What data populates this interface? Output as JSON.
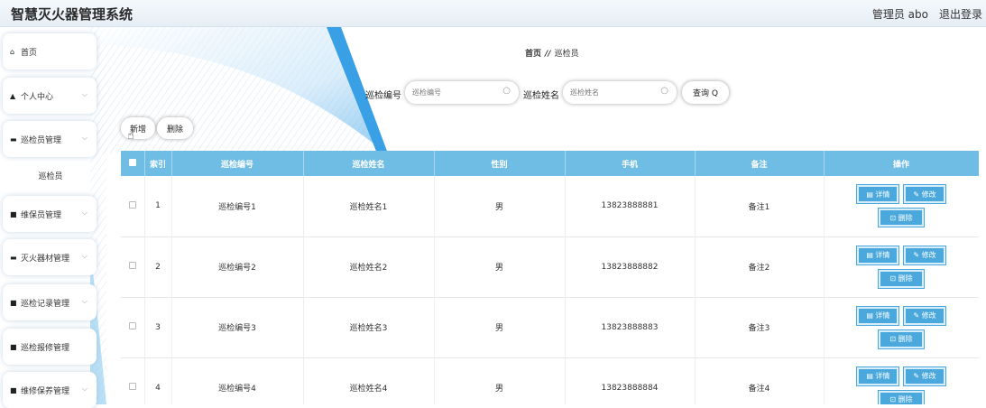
{
  "header": {
    "title": "智慧灭火器管理系统",
    "user": "管理员 abo",
    "logout": "退出登录"
  },
  "sidebar": {
    "items": [
      {
        "icon": "home-icon",
        "glyph": "⌂",
        "label": "首页",
        "has_chevron": false
      },
      {
        "icon": "person-icon",
        "glyph": "▲",
        "label": "个人中心",
        "has_chevron": true
      },
      {
        "icon": "briefcase-icon",
        "glyph": "▬",
        "label": "巡检员管理",
        "has_chevron": true
      },
      {
        "icon": "grid-icon",
        "glyph": "■",
        "label": "维保员管理",
        "has_chevron": true
      },
      {
        "icon": "extinguisher-icon",
        "glyph": "▬",
        "label": "灭火器材管理",
        "has_chevron": true
      },
      {
        "icon": "grid-icon",
        "glyph": "■",
        "label": "巡检记录管理",
        "has_chevron": true
      },
      {
        "icon": "grid-icon",
        "glyph": "■",
        "label": "巡检报修管理",
        "has_chevron": true
      },
      {
        "icon": "grid-icon",
        "glyph": "■",
        "label": "维修保养管理",
        "has_chevron": true
      }
    ],
    "submenu": {
      "label": "巡检员"
    }
  },
  "breadcrumb": {
    "home": "首页",
    "separator": "//",
    "current": "巡检员"
  },
  "search": {
    "field1_label": "巡检编号",
    "field1_placeholder": "巡检编号",
    "field2_label": "巡检姓名",
    "field2_placeholder": "巡检姓名",
    "query_label": "查询 Q"
  },
  "actions": {
    "add": "新增",
    "delete": "删除"
  },
  "table": {
    "columns": [
      "索引",
      "巡检编号",
      "巡检姓名",
      "性别",
      "手机",
      "备注",
      "操作"
    ],
    "rows": [
      {
        "index": "1",
        "code": "巡检编号1",
        "name": "巡检姓名1",
        "gender": "男",
        "phone": "13823888881",
        "remark": "备注1"
      },
      {
        "index": "2",
        "code": "巡检编号2",
        "name": "巡检姓名2",
        "gender": "男",
        "phone": "13823888882",
        "remark": "备注2"
      },
      {
        "index": "3",
        "code": "巡检编号3",
        "name": "巡检姓名3",
        "gender": "男",
        "phone": "13823888883",
        "remark": "备注3"
      },
      {
        "index": "4",
        "code": "巡检编号4",
        "name": "巡检姓名4",
        "gender": "男",
        "phone": "13823888884",
        "remark": "备注4"
      }
    ],
    "ops": {
      "detail": "▤ 详情",
      "edit": "✎ 修改",
      "delete": "⊡ 删除"
    }
  },
  "colors": {
    "table_header": "#6fbce4",
    "op_button": "#4aa8dc",
    "deco_blue": "#3aa0e6"
  }
}
